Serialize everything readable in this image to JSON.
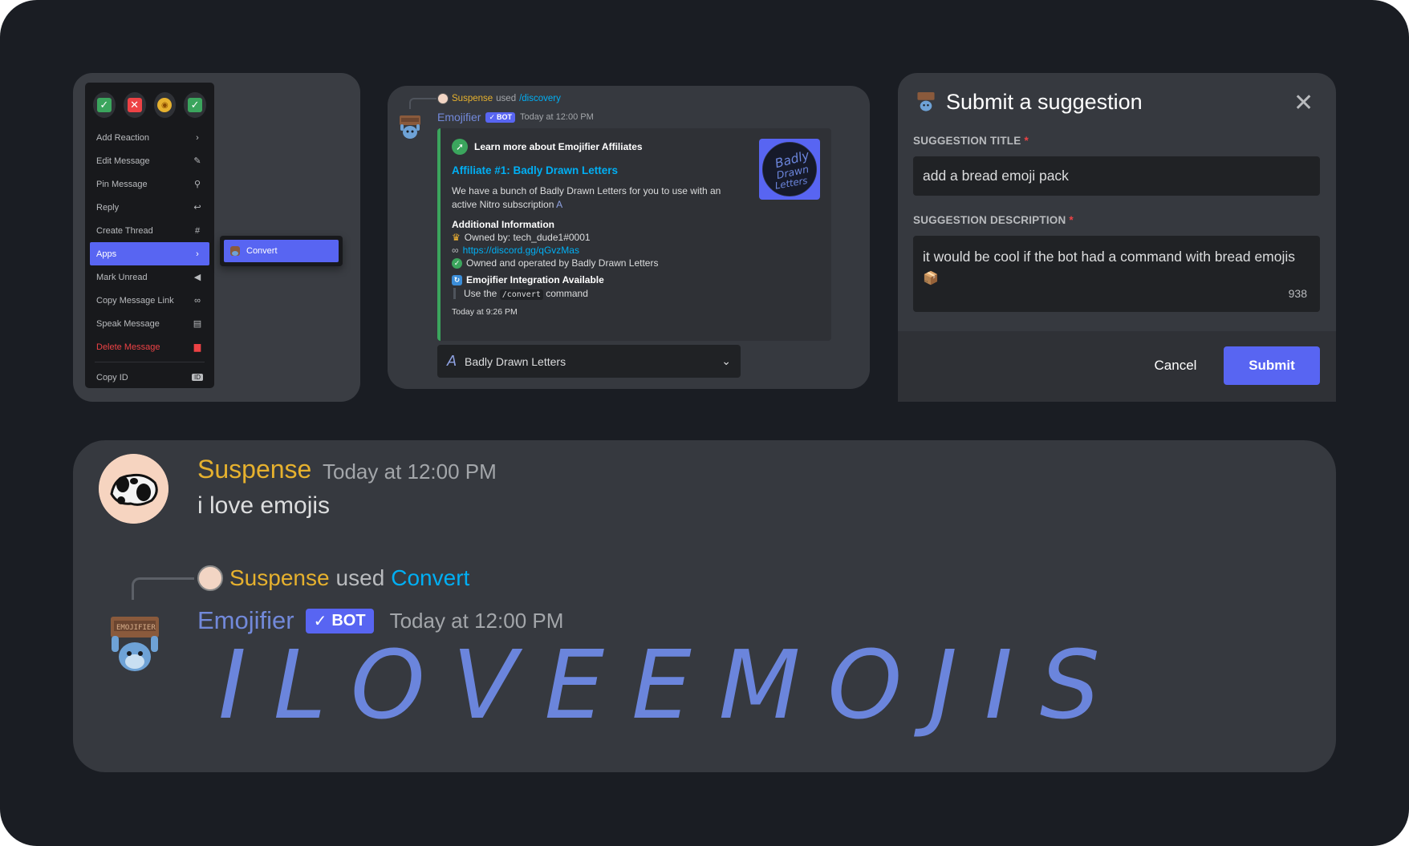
{
  "context_menu": {
    "reactions": [
      {
        "icon": "check-emoji-icon",
        "glyph": "✓",
        "color": "#3ba55d"
      },
      {
        "icon": "x-emoji-icon",
        "glyph": "✕",
        "color": "#ed4245"
      },
      {
        "icon": "tongue-emoji-icon",
        "glyph": "😋",
        "color": "#e6b12e"
      },
      {
        "icon": "check-emoji-icon",
        "glyph": "✓",
        "color": "#3ba55d"
      }
    ],
    "items": [
      {
        "label": "Add Reaction",
        "icon": "chevron-right-icon",
        "glyph": "›"
      },
      {
        "label": "Edit Message",
        "icon": "pencil-icon",
        "glyph": "✎"
      },
      {
        "label": "Pin Message",
        "icon": "pin-icon",
        "glyph": "📌"
      },
      {
        "label": "Reply",
        "icon": "reply-icon",
        "glyph": "↩"
      },
      {
        "label": "Create Thread",
        "icon": "thread-icon",
        "glyph": "#"
      },
      {
        "label": "Apps",
        "icon": "chevron-right-icon",
        "glyph": "›"
      },
      {
        "label": "Mark Unread",
        "icon": "flag-icon",
        "glyph": "◀"
      },
      {
        "label": "Copy Message Link",
        "icon": "link-icon",
        "glyph": "🔗"
      },
      {
        "label": "Speak Message",
        "icon": "speak-icon",
        "glyph": "💬"
      },
      {
        "label": "Delete Message",
        "icon": "trash-icon",
        "glyph": "🗑"
      }
    ],
    "copy_id": {
      "label": "Copy ID",
      "icon": "id-icon",
      "glyph": "ID"
    },
    "submenu": {
      "label": "Convert"
    }
  },
  "embed_message": {
    "reply_user": "Suspense",
    "reply_used": "used",
    "reply_command": "/discovery",
    "bot_name": "Emojifier",
    "bot_tag": "BOT",
    "timestamp": "Today at 12:00 PM",
    "embed": {
      "author": "Learn more about Emojifier Affiliates",
      "title": "Affiliate #1: Badly Drawn Letters",
      "description": "We have a bunch of Badly Drawn Letters for you to use with an active Nitro subscription",
      "field_name": "Additional Information",
      "owner": "Owned by: tech_dude1#0001",
      "invite": "https://discord.gg/qGvzMas",
      "operated": "Owned and operated by Badly Drawn Letters",
      "integration_title": "Emojifier Integration Available",
      "use_prefix": "Use the",
      "use_command": "/convert",
      "use_suffix": "command",
      "footer": "Today at 9:26 PM",
      "thumbnail_text": "Badly Drawn Letters",
      "accent_color": "#3ba55d"
    },
    "select": {
      "value": "Badly Drawn Letters"
    }
  },
  "modal": {
    "title": "Submit a suggestion",
    "title_label": "SUGGESTION TITLE",
    "title_value": "add a bread emoji pack",
    "desc_label": "SUGGESTION DESCRIPTION",
    "desc_value": "it would be cool if the bot had a command with bread emojis",
    "desc_emoji": "📦",
    "char_count": "938",
    "required_mark": "*",
    "cancel": "Cancel",
    "submit": "Submit"
  },
  "chat": {
    "user": "Suspense",
    "time": "Today at 12:00 PM",
    "message": "i love emojis",
    "reply_user": "Suspense",
    "reply_used": "used",
    "reply_command": "Convert",
    "bot_name": "Emojifier",
    "bot_tag": "BOT",
    "bot_time": "Today at 12:00 PM",
    "converted_text": "ILOVEEMOJIS"
  },
  "colors": {
    "blurple": "#5865f2",
    "gold_username": "#e6b12e",
    "bot_name": "#7289da",
    "danger": "#ed4245",
    "link": "#00aff4"
  }
}
